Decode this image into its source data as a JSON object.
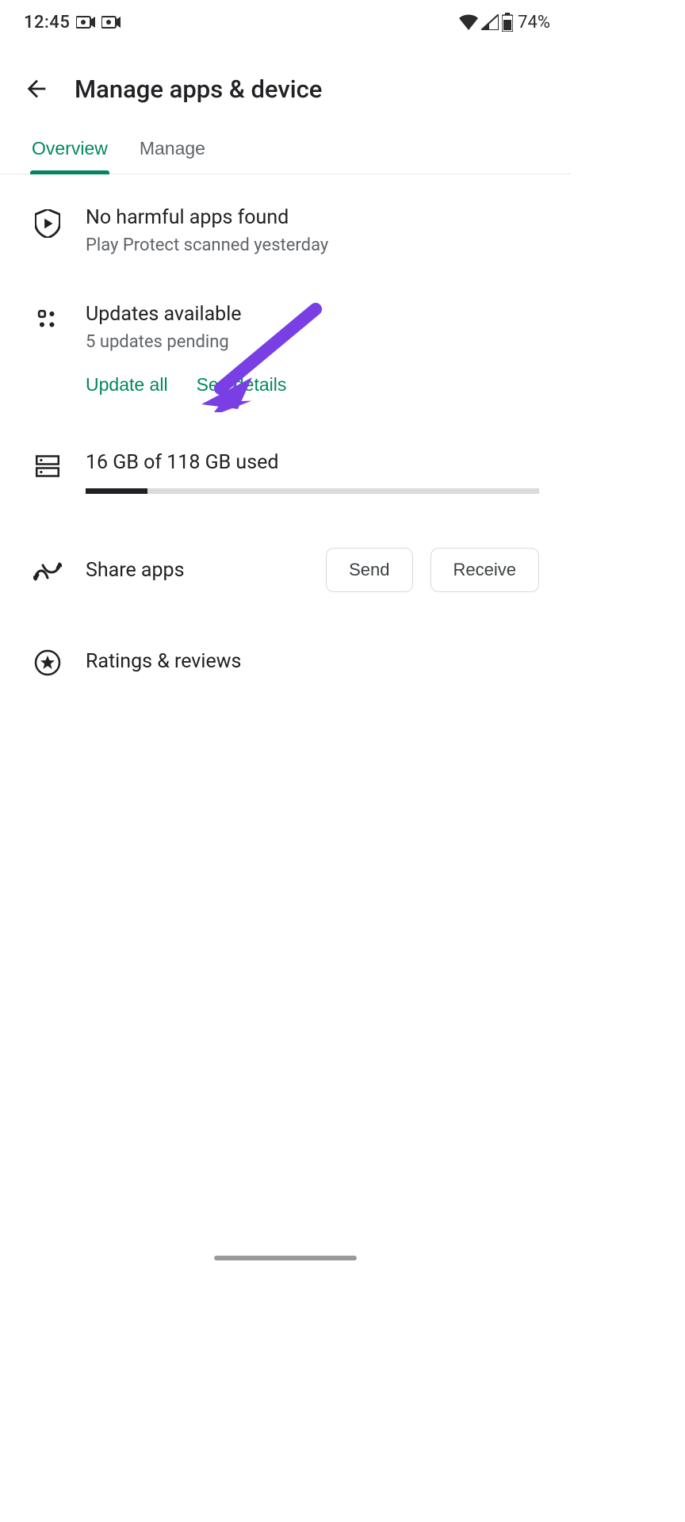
{
  "status": {
    "time": "12:45",
    "battery_pct": "74%"
  },
  "header": {
    "title": "Manage apps & device"
  },
  "tabs": {
    "overview": "Overview",
    "manage": "Manage"
  },
  "protect": {
    "title": "No harmful apps found",
    "sub": "Play Protect scanned yesterday"
  },
  "updates": {
    "title": "Updates available",
    "sub": "5 updates pending",
    "update_all": "Update all",
    "see_details": "See details"
  },
  "storage": {
    "label": "16 GB of 118 GB used",
    "used": 16,
    "total": 118
  },
  "share": {
    "label": "Share apps",
    "send": "Send",
    "receive": "Receive"
  },
  "ratings": {
    "label": "Ratings & reviews"
  },
  "annotation": {
    "color": "#7a3fe4"
  }
}
